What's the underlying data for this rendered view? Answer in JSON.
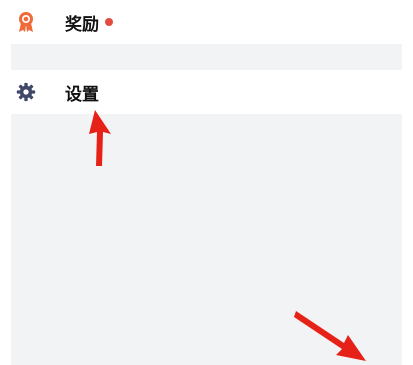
{
  "menu": {
    "items": [
      {
        "label": "奖励",
        "icon": "medal-icon",
        "badge": true
      },
      {
        "label": "设置",
        "icon": "gear-icon"
      }
    ]
  },
  "colors": {
    "medal": "#f06b3b",
    "gear": "#40486a",
    "badge": "#e44a3f",
    "annotation_arrow": "#e62117",
    "panel_bg": "#f2f3f5"
  }
}
